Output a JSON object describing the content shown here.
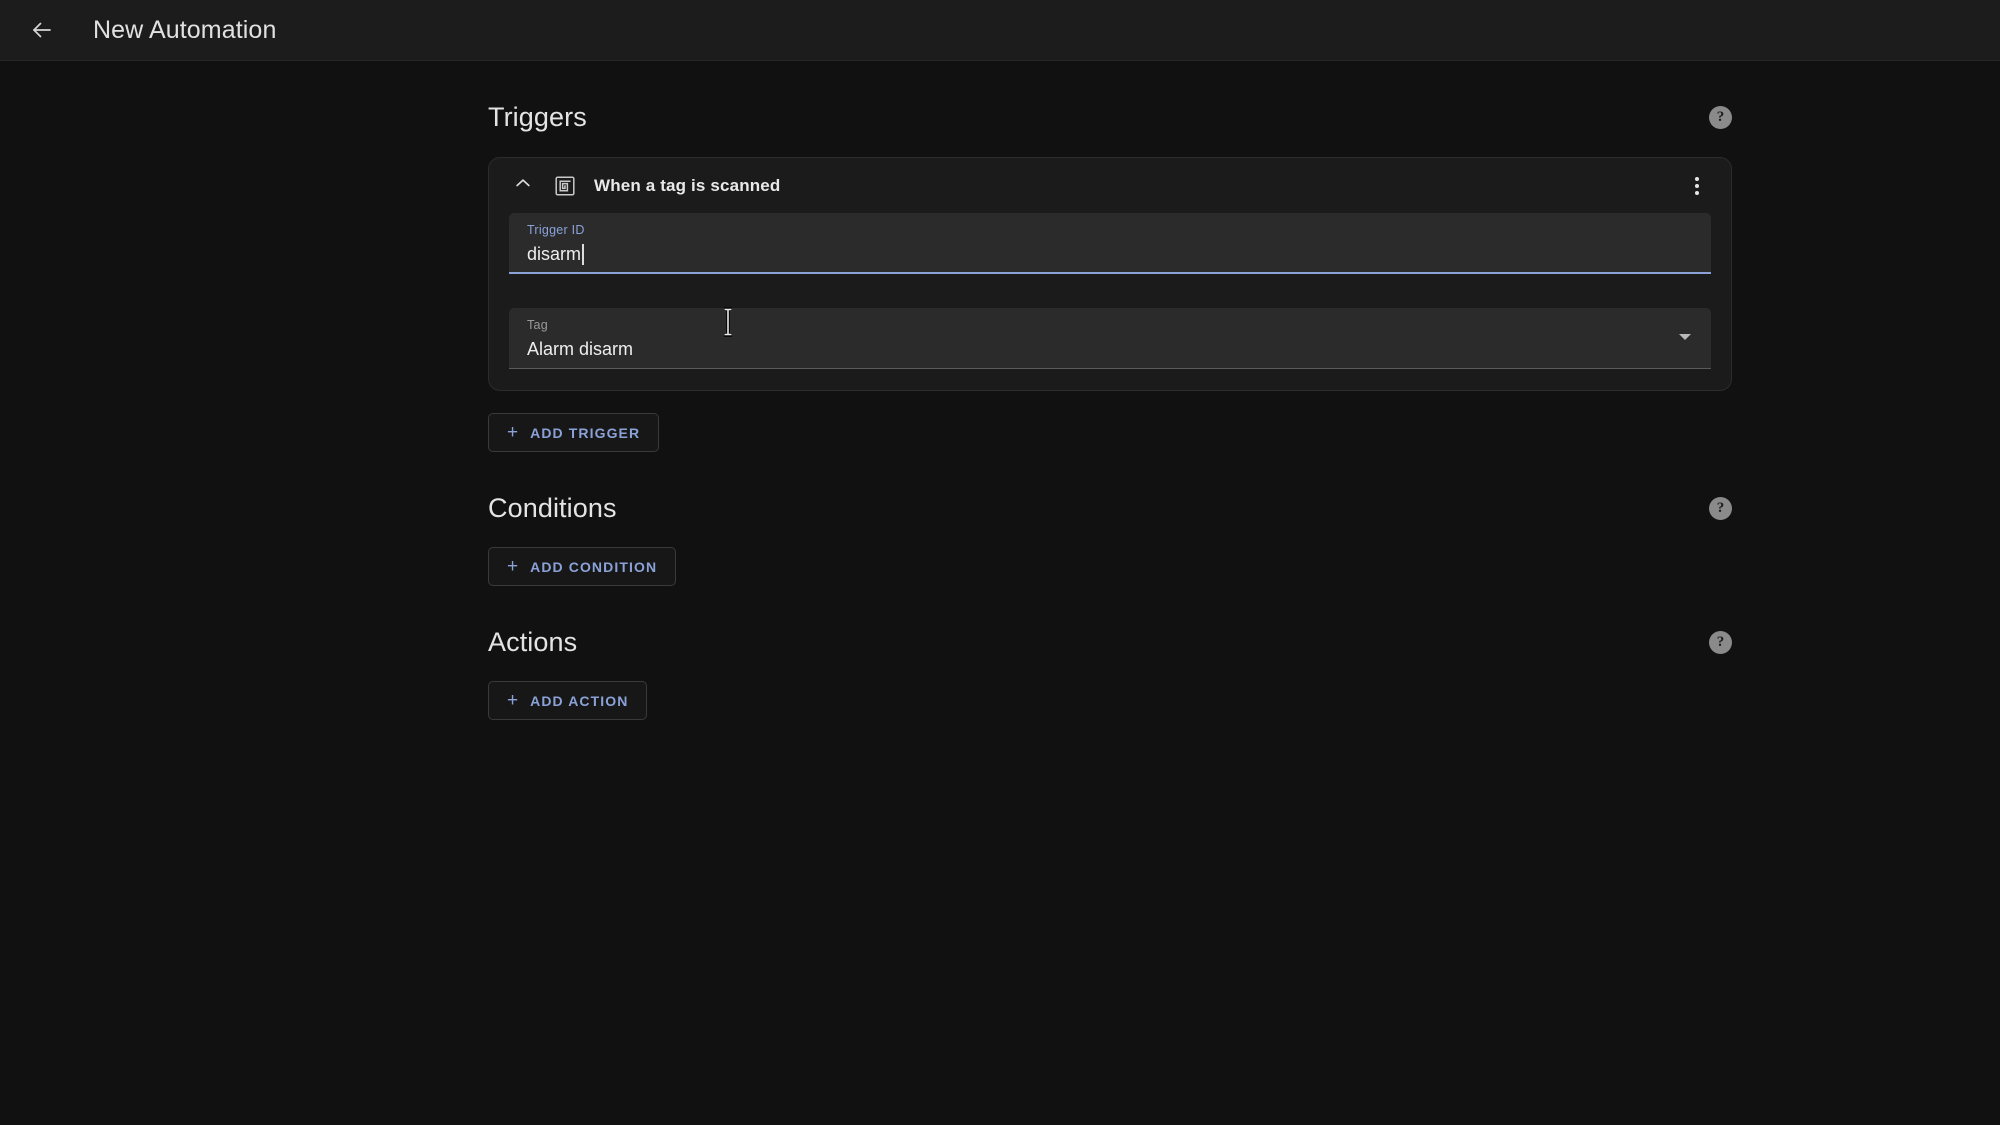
{
  "appbar": {
    "back_icon": "arrow-left-icon",
    "title": "New Automation"
  },
  "sections": {
    "triggers": {
      "title": "Triggers",
      "help_glyph": "?",
      "add_button": {
        "plus": "+",
        "label": "ADD TRIGGER"
      }
    },
    "conditions": {
      "title": "Conditions",
      "help_glyph": "?",
      "add_button": {
        "plus": "+",
        "label": "ADD CONDITION"
      }
    },
    "actions": {
      "title": "Actions",
      "help_glyph": "?",
      "add_button": {
        "plus": "+",
        "label": "ADD ACTION"
      }
    }
  },
  "trigger_card": {
    "collapse_icon": "chevron-up-icon",
    "type_icon": "nfc-tag-icon",
    "title": "When a tag is scanned",
    "overflow_icon": "more-vertical-icon",
    "fields": [
      {
        "name": "trigger-id",
        "label": "Trigger ID",
        "value": "disarm",
        "kind": "text",
        "focused": true
      },
      {
        "name": "tag",
        "label": "Tag",
        "value": "Alarm disarm",
        "kind": "select",
        "focused": false
      }
    ]
  },
  "colors": {
    "accent": "#8ba2d8",
    "page_background": "#111111",
    "appbar_background": "#1c1c1c",
    "card_background": "#1b1b1b",
    "field_background": "#2b2b2b"
  }
}
